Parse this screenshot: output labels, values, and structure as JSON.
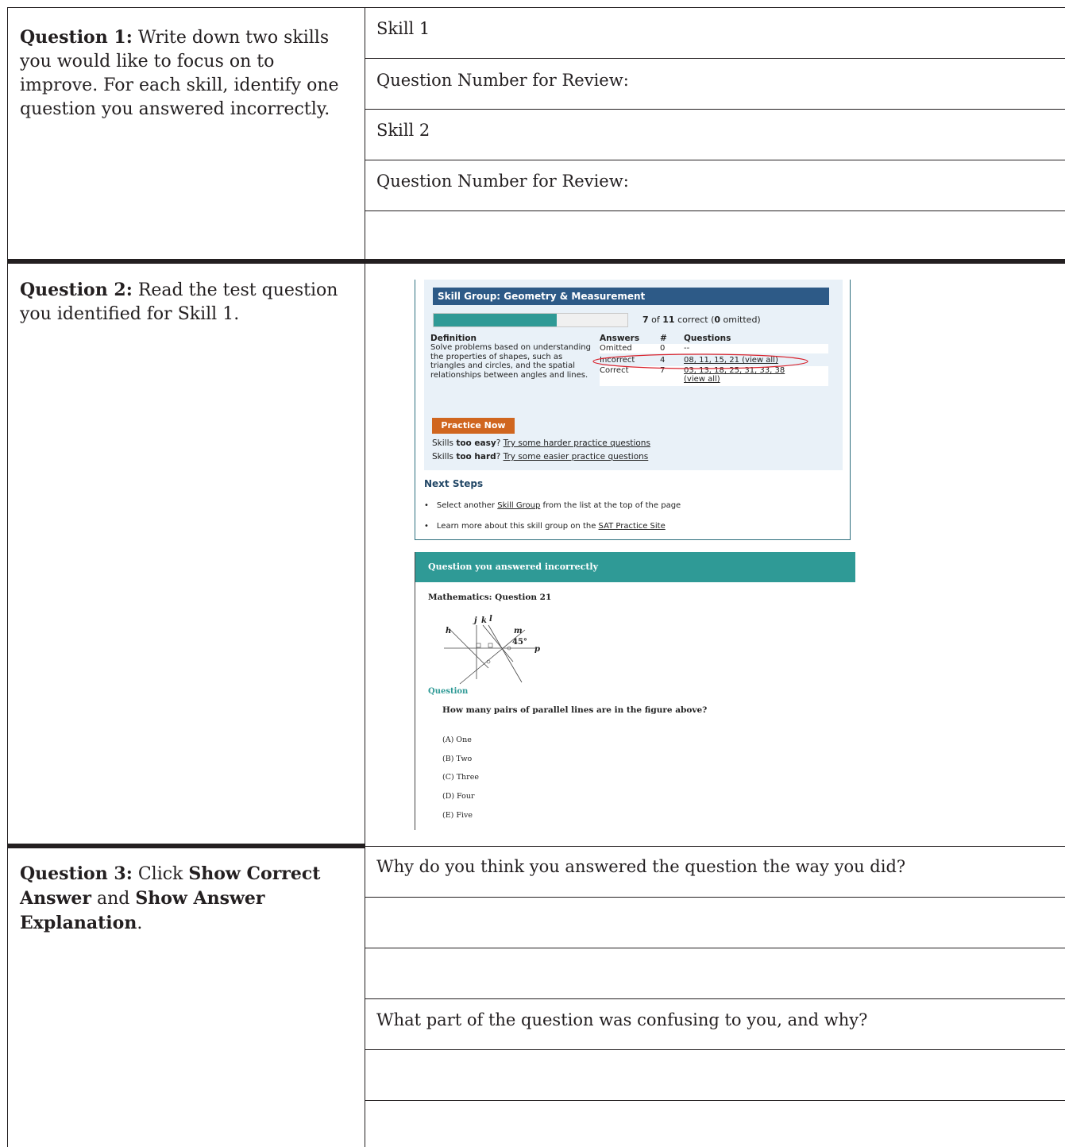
{
  "q1": {
    "label": "Question 1:",
    "text": " Write down two skills you would like to focus on to improve. For each skill, identify one question you answered incorrectly.",
    "rows": [
      "Skill 1",
      "Question Number for Review:",
      "Skill 2",
      "Question Number for Review:",
      ""
    ]
  },
  "q2": {
    "label": "Question 2:",
    "text": " Read the test question you identified for Skill 1."
  },
  "q3": {
    "label": "Question 3:",
    "text_a": " Click ",
    "bold_a": "Show Correct Answer",
    "text_b": " and ",
    "bold_b": "Show Answer Explanation",
    "text_c": ".",
    "rows": [
      "Why do you think you answered the question the way you did?",
      "",
      "",
      "What part of the question was confusing to you, and why?",
      "",
      ""
    ]
  },
  "skill_group": {
    "header": "Skill Group: Geometry & Measurement",
    "progress_fraction": 0.636,
    "score_correct": "7",
    "score_of": " of ",
    "score_total": "11",
    "score_mid": " correct (",
    "score_omitted": "0",
    "score_end": " omitted)",
    "definition_heading": "Definition",
    "definition_text": "Solve problems based on understanding the properties of shapes, such as triangles and circles, and the spatial relationships between angles and lines.",
    "col_answers": "Answers",
    "col_count": "#",
    "col_questions": "Questions",
    "rows": [
      {
        "answer": "Omitted",
        "count": "0",
        "questions": "--"
      },
      {
        "answer": "Incorrect",
        "count": "4",
        "questions": "08, 11, 15, 21 (view all)"
      },
      {
        "answer": "Correct",
        "count": "7",
        "questions": "03, 13, 18, 25, 31, 33, 38",
        "more": "(view all)"
      }
    ],
    "practice_button": "Practice Now",
    "easy_prefix": "Skills ",
    "easy_bold": "too easy",
    "easy_q": "? ",
    "easy_link": "Try some harder practice questions",
    "hard_prefix": "Skills ",
    "hard_bold": "too hard",
    "hard_q": "? ",
    "hard_link": "Try some easier practice questions",
    "next_steps": "Next Steps",
    "bullet1_pre": "Select another ",
    "bullet1_link": "Skill Group",
    "bullet1_post": " from the list at the top of the page",
    "bullet2_pre": "Learn more about this skill group on the ",
    "bullet2_link": "SAT Practice Site",
    "highlight_color": "#d9232d"
  },
  "question_panel": {
    "bar_title": "Question you answered incorrectly",
    "title": "Mathematics: Question 21",
    "figure_labels": {
      "h": "h",
      "j": "j",
      "k": "k",
      "l": "l",
      "m": "m",
      "p": "p",
      "angle": "45°"
    },
    "question_label": "Question",
    "question_text": "How many pairs of parallel lines are in the figure above?",
    "choices": [
      "(A) One",
      "(B) Two",
      "(C) Three",
      "(D) Four",
      "(E) Five"
    ]
  }
}
